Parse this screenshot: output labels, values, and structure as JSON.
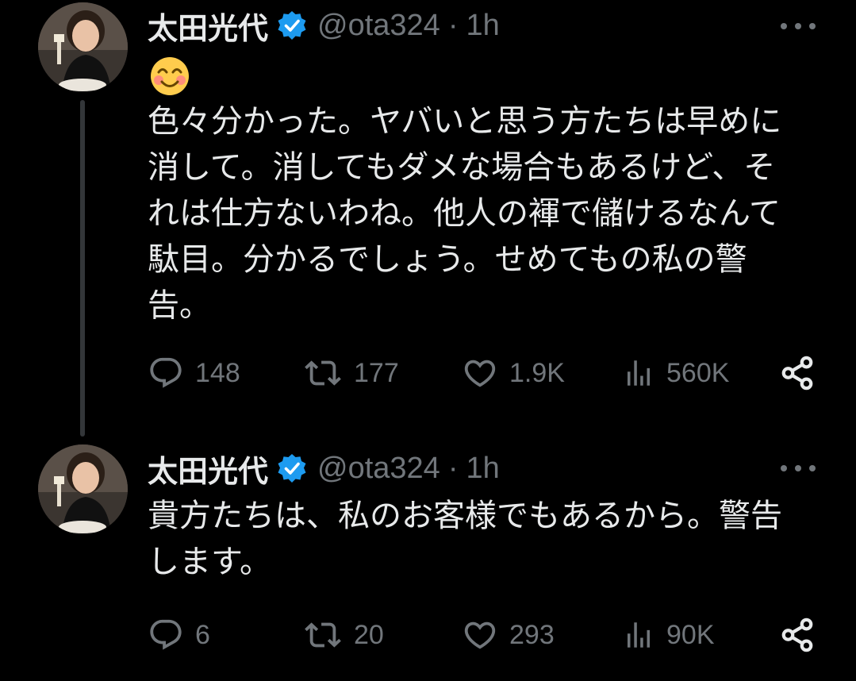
{
  "tweets": [
    {
      "author_name": "太田光代",
      "handle": "@ota324",
      "separator": "·",
      "time": "1h",
      "emoji": "smiling-face-with-smiling-eyes",
      "text": "色々分かった。ヤバいと思う方たちは早めに\n消して。消してもダメな場合もあるけど、そ\nれは仕方ないわね。他人の褌で儲けるなんて\n駄目。分かるでしょう。せめてもの私の警\n告。",
      "stats": {
        "replies": "148",
        "retweets": "177",
        "likes": "1.9K",
        "views": "560K"
      }
    },
    {
      "author_name": "太田光代",
      "handle": "@ota324",
      "separator": "·",
      "time": "1h",
      "text": "貴方たちは、私のお客様でもあるから。警告\nします。",
      "stats": {
        "replies": "6",
        "retweets": "20",
        "likes": "293",
        "views": "90K"
      }
    }
  ],
  "colors": {
    "background": "#000000",
    "text": "#e7e9ea",
    "muted": "#71767b",
    "verified": "#1d9bf0",
    "thread_line": "#333639"
  },
  "icons": {
    "reply": "reply-icon",
    "retweet": "retweet-icon",
    "like": "heart-icon",
    "views": "views-icon",
    "share": "share-icon",
    "more": "more-icon",
    "verified": "verified-badge-icon"
  }
}
